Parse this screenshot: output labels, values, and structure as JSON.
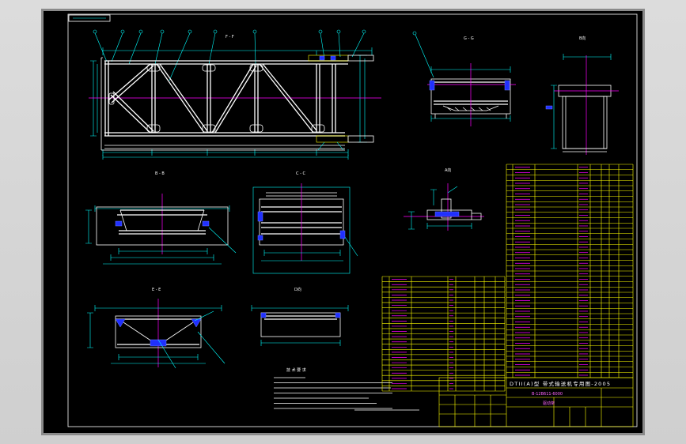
{
  "colors": {
    "sheet_background": "#000000",
    "outline": "#ffffff",
    "dimension": "#00ffff",
    "centerline": "#ff00ff",
    "table": "#ffff00",
    "part_fill": "#2030ff"
  },
  "views": {
    "main_section": "F - F",
    "top_right_section": "G - G",
    "right_view": "B向",
    "middle_left_section": "B - B",
    "middle_section": "C - C",
    "detail_view": "A向",
    "bottom_left_section": "E - E",
    "bottom_view": "D向"
  },
  "notes": {
    "technical_requirements_title": "技 术 要 求"
  },
  "title_block": {
    "series_title": "DTII(A)型 带式输送机专用图-2005",
    "drawing_number": "B-12B611-6000",
    "part_name": "驱动架"
  }
}
